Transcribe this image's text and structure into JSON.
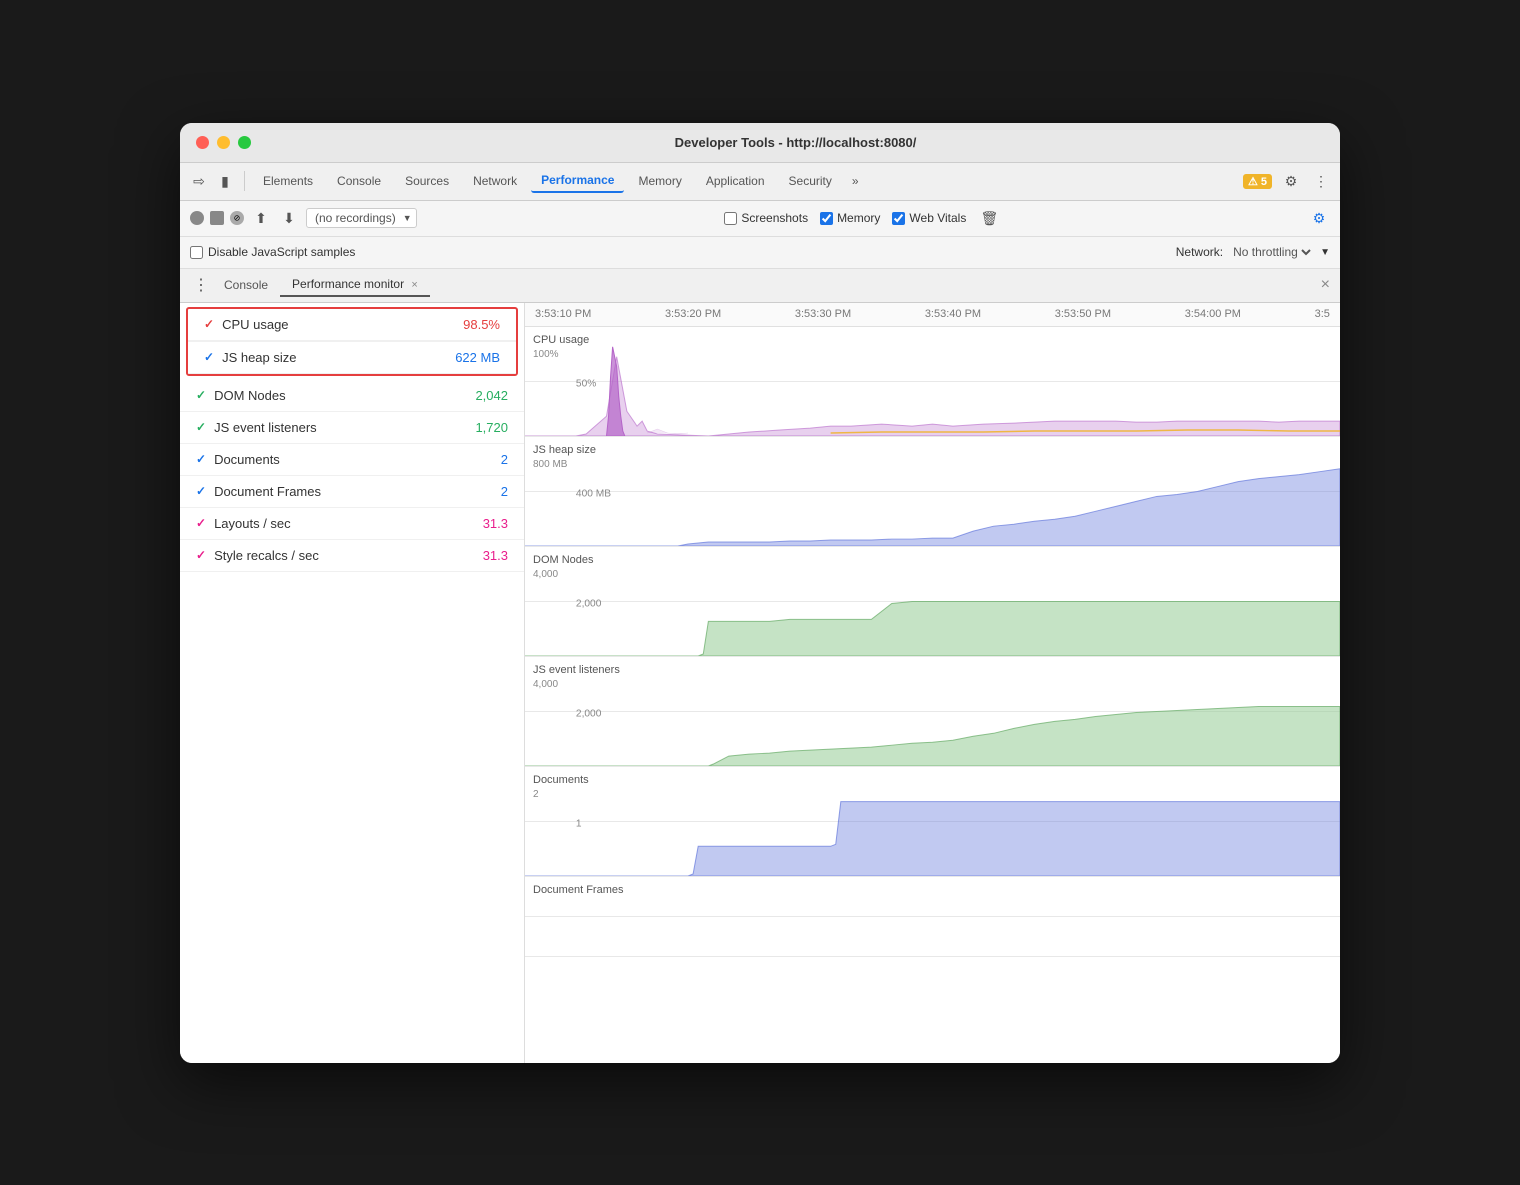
{
  "window": {
    "title": "Developer Tools - http://localhost:8080/"
  },
  "toolbar": {
    "tabs": [
      {
        "label": "Elements",
        "active": false
      },
      {
        "label": "Console",
        "active": false
      },
      {
        "label": "Sources",
        "active": false
      },
      {
        "label": "Network",
        "active": false
      },
      {
        "label": "Performance",
        "active": true
      },
      {
        "label": "Memory",
        "active": false
      },
      {
        "label": "Application",
        "active": false
      },
      {
        "label": "Security",
        "active": false
      }
    ],
    "more_label": "»",
    "warning_count": "⚠ 5"
  },
  "recording": {
    "dropdown_value": "(no recordings)",
    "screenshots_label": "Screenshots",
    "memory_label": "Memory",
    "web_vitals_label": "Web Vitals"
  },
  "filter": {
    "disable_js_label": "Disable JavaScript samples",
    "network_label": "Network:",
    "throttle_value": "No throttling"
  },
  "tabs_bar": {
    "console_tab": "Console",
    "monitor_tab": "Performance monitor",
    "close_label": "×"
  },
  "metrics": [
    {
      "id": "cpu",
      "check": "✓",
      "check_color": "check-red",
      "name": "CPU usage",
      "value": "98.5%",
      "value_color": "val-red",
      "highlighted": true
    },
    {
      "id": "heap",
      "check": "✓",
      "check_color": "check-blue",
      "name": "JS heap size",
      "value": "622 MB",
      "value_color": "val-blue",
      "highlighted": true
    },
    {
      "id": "dom",
      "check": "✓",
      "check_color": "check-green",
      "name": "DOM Nodes",
      "value": "2,042",
      "value_color": "val-green",
      "highlighted": false
    },
    {
      "id": "events",
      "check": "✓",
      "check_color": "check-green",
      "name": "JS event listeners",
      "value": "1,720",
      "value_color": "val-green",
      "highlighted": false
    },
    {
      "id": "docs",
      "check": "✓",
      "check_color": "check-blue",
      "name": "Documents",
      "value": "2",
      "value_color": "val-blue",
      "highlighted": false
    },
    {
      "id": "frames",
      "check": "✓",
      "check_color": "check-blue",
      "name": "Document Frames",
      "value": "2",
      "value_color": "val-blue",
      "highlighted": false
    },
    {
      "id": "layouts",
      "check": "✓",
      "check_color": "check-pink",
      "name": "Layouts / sec",
      "value": "31.3",
      "value_color": "val-pink",
      "highlighted": false
    },
    {
      "id": "style",
      "check": "✓",
      "check_color": "check-pink",
      "name": "Style recalcs / sec",
      "value": "31.3",
      "value_color": "val-pink",
      "highlighted": false
    }
  ],
  "time_labels": [
    "3:53:10 PM",
    "3:53:20 PM",
    "3:53:30 PM",
    "3:53:40 PM",
    "3:53:50 PM",
    "3:54:00 PM",
    "3:5"
  ],
  "charts": {
    "cpu": {
      "title": "CPU usage",
      "sublabel": "100%",
      "mid_label": "50%"
    },
    "heap": {
      "title": "JS heap size",
      "sublabel": "800 MB",
      "mid_label": "400 MB"
    },
    "dom": {
      "title": "DOM Nodes",
      "sublabel": "4,000",
      "mid_label": "2,000"
    },
    "events": {
      "title": "JS event listeners",
      "sublabel": "4,000",
      "mid_label": "2,000"
    },
    "docs": {
      "title": "Documents",
      "sublabel": "2",
      "mid_label": "1"
    },
    "frames": {
      "title": "Document Frames"
    }
  },
  "colors": {
    "cpu_fill": "rgba(180, 100, 200, 0.3)",
    "cpu_stroke": "#b464c8",
    "cpu_orange": "rgba(240, 180, 50, 0.8)",
    "heap_fill": "rgba(100, 120, 220, 0.4)",
    "heap_stroke": "#6478dc",
    "dom_fill": "rgba(140, 200, 140, 0.5)",
    "dom_stroke": "#8cc88c",
    "events_fill": "rgba(140, 200, 140, 0.5)",
    "events_stroke": "#8cc88c",
    "docs_fill": "rgba(100, 120, 220, 0.4)",
    "docs_stroke": "#6478dc",
    "frames_fill": "rgba(100, 120, 220, 0.4)"
  }
}
